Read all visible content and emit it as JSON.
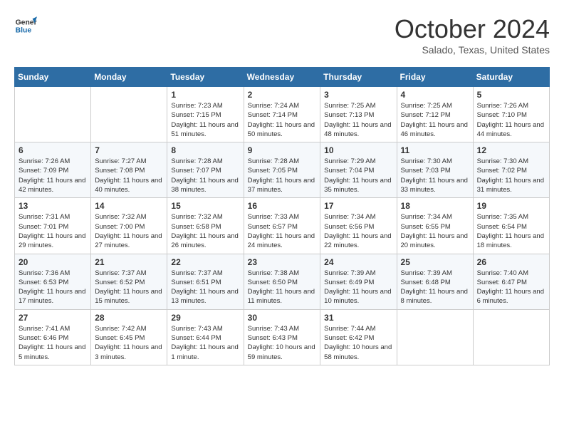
{
  "logo": {
    "line1": "General",
    "line2": "Blue"
  },
  "title": "October 2024",
  "location": "Salado, Texas, United States",
  "headers": [
    "Sunday",
    "Monday",
    "Tuesday",
    "Wednesday",
    "Thursday",
    "Friday",
    "Saturday"
  ],
  "weeks": [
    [
      {
        "day": "",
        "info": ""
      },
      {
        "day": "",
        "info": ""
      },
      {
        "day": "1",
        "info": "Sunrise: 7:23 AM\nSunset: 7:15 PM\nDaylight: 11 hours and 51 minutes."
      },
      {
        "day": "2",
        "info": "Sunrise: 7:24 AM\nSunset: 7:14 PM\nDaylight: 11 hours and 50 minutes."
      },
      {
        "day": "3",
        "info": "Sunrise: 7:25 AM\nSunset: 7:13 PM\nDaylight: 11 hours and 48 minutes."
      },
      {
        "day": "4",
        "info": "Sunrise: 7:25 AM\nSunset: 7:12 PM\nDaylight: 11 hours and 46 minutes."
      },
      {
        "day": "5",
        "info": "Sunrise: 7:26 AM\nSunset: 7:10 PM\nDaylight: 11 hours and 44 minutes."
      }
    ],
    [
      {
        "day": "6",
        "info": "Sunrise: 7:26 AM\nSunset: 7:09 PM\nDaylight: 11 hours and 42 minutes."
      },
      {
        "day": "7",
        "info": "Sunrise: 7:27 AM\nSunset: 7:08 PM\nDaylight: 11 hours and 40 minutes."
      },
      {
        "day": "8",
        "info": "Sunrise: 7:28 AM\nSunset: 7:07 PM\nDaylight: 11 hours and 38 minutes."
      },
      {
        "day": "9",
        "info": "Sunrise: 7:28 AM\nSunset: 7:05 PM\nDaylight: 11 hours and 37 minutes."
      },
      {
        "day": "10",
        "info": "Sunrise: 7:29 AM\nSunset: 7:04 PM\nDaylight: 11 hours and 35 minutes."
      },
      {
        "day": "11",
        "info": "Sunrise: 7:30 AM\nSunset: 7:03 PM\nDaylight: 11 hours and 33 minutes."
      },
      {
        "day": "12",
        "info": "Sunrise: 7:30 AM\nSunset: 7:02 PM\nDaylight: 11 hours and 31 minutes."
      }
    ],
    [
      {
        "day": "13",
        "info": "Sunrise: 7:31 AM\nSunset: 7:01 PM\nDaylight: 11 hours and 29 minutes."
      },
      {
        "day": "14",
        "info": "Sunrise: 7:32 AM\nSunset: 7:00 PM\nDaylight: 11 hours and 27 minutes."
      },
      {
        "day": "15",
        "info": "Sunrise: 7:32 AM\nSunset: 6:58 PM\nDaylight: 11 hours and 26 minutes."
      },
      {
        "day": "16",
        "info": "Sunrise: 7:33 AM\nSunset: 6:57 PM\nDaylight: 11 hours and 24 minutes."
      },
      {
        "day": "17",
        "info": "Sunrise: 7:34 AM\nSunset: 6:56 PM\nDaylight: 11 hours and 22 minutes."
      },
      {
        "day": "18",
        "info": "Sunrise: 7:34 AM\nSunset: 6:55 PM\nDaylight: 11 hours and 20 minutes."
      },
      {
        "day": "19",
        "info": "Sunrise: 7:35 AM\nSunset: 6:54 PM\nDaylight: 11 hours and 18 minutes."
      }
    ],
    [
      {
        "day": "20",
        "info": "Sunrise: 7:36 AM\nSunset: 6:53 PM\nDaylight: 11 hours and 17 minutes."
      },
      {
        "day": "21",
        "info": "Sunrise: 7:37 AM\nSunset: 6:52 PM\nDaylight: 11 hours and 15 minutes."
      },
      {
        "day": "22",
        "info": "Sunrise: 7:37 AM\nSunset: 6:51 PM\nDaylight: 11 hours and 13 minutes."
      },
      {
        "day": "23",
        "info": "Sunrise: 7:38 AM\nSunset: 6:50 PM\nDaylight: 11 hours and 11 minutes."
      },
      {
        "day": "24",
        "info": "Sunrise: 7:39 AM\nSunset: 6:49 PM\nDaylight: 11 hours and 10 minutes."
      },
      {
        "day": "25",
        "info": "Sunrise: 7:39 AM\nSunset: 6:48 PM\nDaylight: 11 hours and 8 minutes."
      },
      {
        "day": "26",
        "info": "Sunrise: 7:40 AM\nSunset: 6:47 PM\nDaylight: 11 hours and 6 minutes."
      }
    ],
    [
      {
        "day": "27",
        "info": "Sunrise: 7:41 AM\nSunset: 6:46 PM\nDaylight: 11 hours and 5 minutes."
      },
      {
        "day": "28",
        "info": "Sunrise: 7:42 AM\nSunset: 6:45 PM\nDaylight: 11 hours and 3 minutes."
      },
      {
        "day": "29",
        "info": "Sunrise: 7:43 AM\nSunset: 6:44 PM\nDaylight: 11 hours and 1 minute."
      },
      {
        "day": "30",
        "info": "Sunrise: 7:43 AM\nSunset: 6:43 PM\nDaylight: 10 hours and 59 minutes."
      },
      {
        "day": "31",
        "info": "Sunrise: 7:44 AM\nSunset: 6:42 PM\nDaylight: 10 hours and 58 minutes."
      },
      {
        "day": "",
        "info": ""
      },
      {
        "day": "",
        "info": ""
      }
    ]
  ]
}
